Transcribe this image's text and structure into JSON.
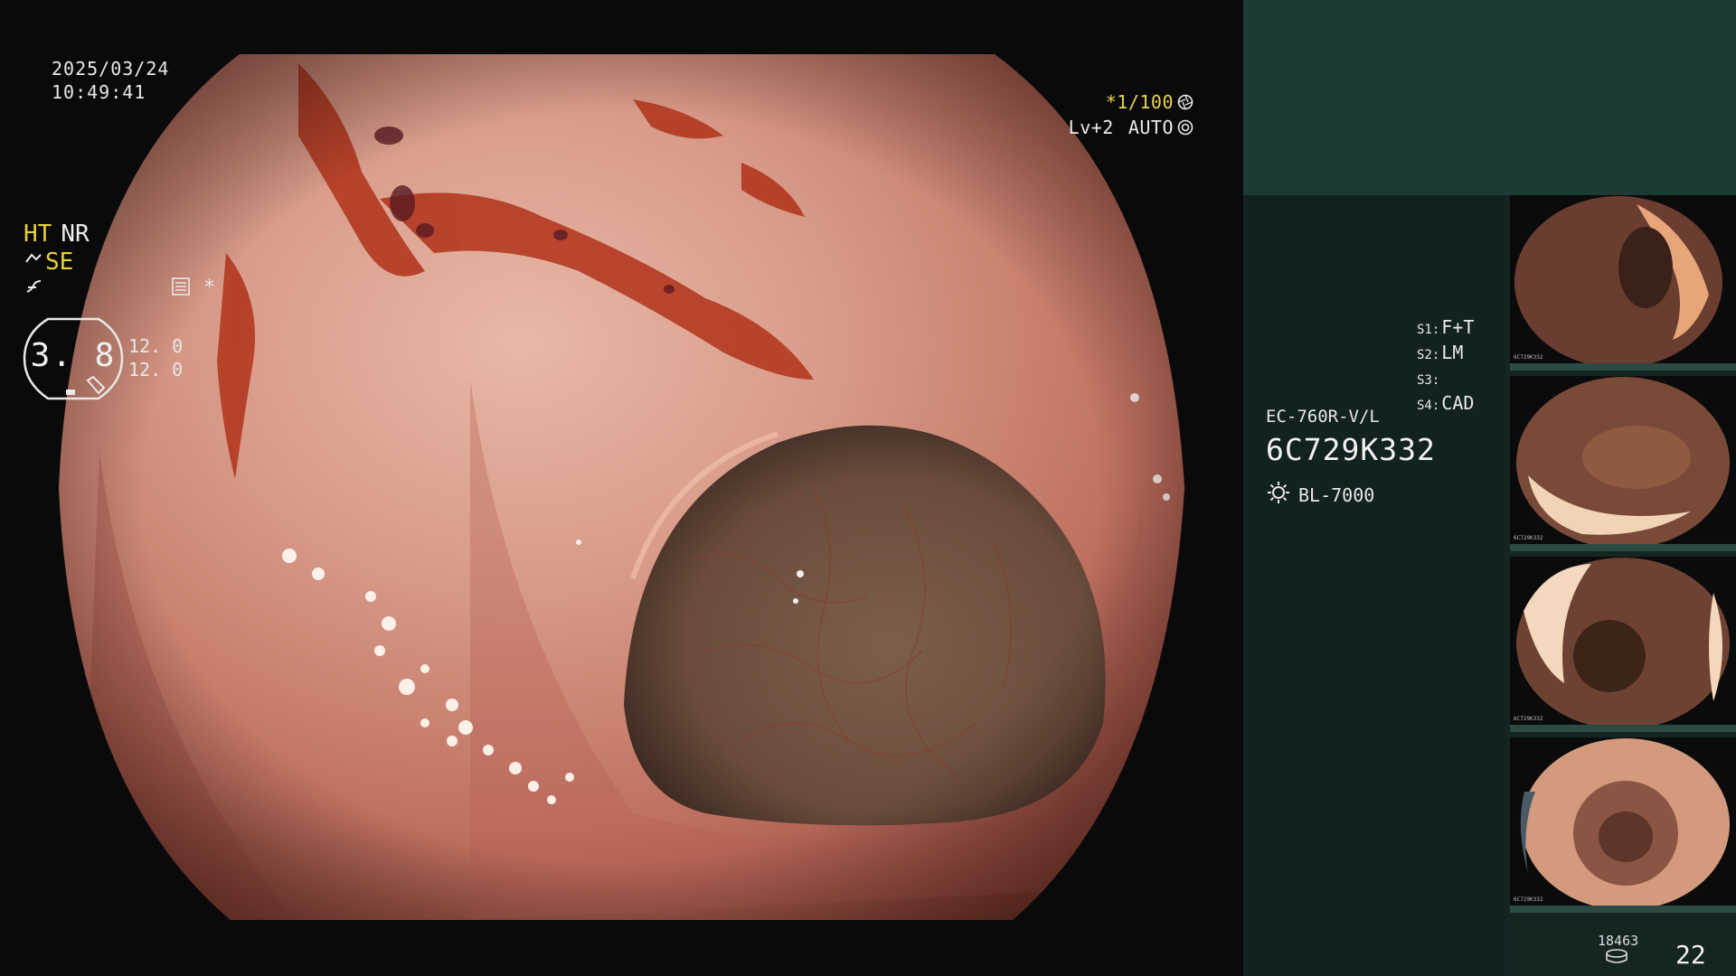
{
  "datetime": {
    "date": "2025/03/24",
    "time": "10:49:41"
  },
  "scope_status": {
    "shutter": "*1/100",
    "level": "Lv+2",
    "mode": "AUTO"
  },
  "panel": {
    "mode_row1": {
      "ht": "HT",
      "nr": "NR"
    },
    "mode_row2": {
      "se": "SE"
    },
    "star": "*",
    "gauge": {
      "value": "3. 8",
      "upper": "12. 0",
      "lower": "12. 0"
    },
    "switches": {
      "s1_label": "S1:",
      "s1_value": "F+T",
      "s2_label": "S2:",
      "s2_value": "LM",
      "s3_label": "S3:",
      "s3_value": "",
      "s4_label": "S4:",
      "s4_value": "CAD"
    },
    "scope_model": "EC-760R-V/L",
    "scope_serial": "6C729K332",
    "light_source": "BL-7000"
  },
  "thumbnails": [
    {
      "name": "thumbnail-1",
      "caption": "6C729K332"
    },
    {
      "name": "thumbnail-2",
      "caption": "6C729K332"
    },
    {
      "name": "thumbnail-3",
      "caption": "6C729K332"
    },
    {
      "name": "thumbnail-4",
      "caption": "6C729K332"
    }
  ],
  "counter": {
    "images": "18463",
    "count": "22"
  },
  "colors": {
    "panel_bg": "#142522",
    "panel_top": "#1e3a35",
    "accent_yellow": "#e6d23a",
    "mucosa": "#c97a6a",
    "text": "#ececec"
  }
}
